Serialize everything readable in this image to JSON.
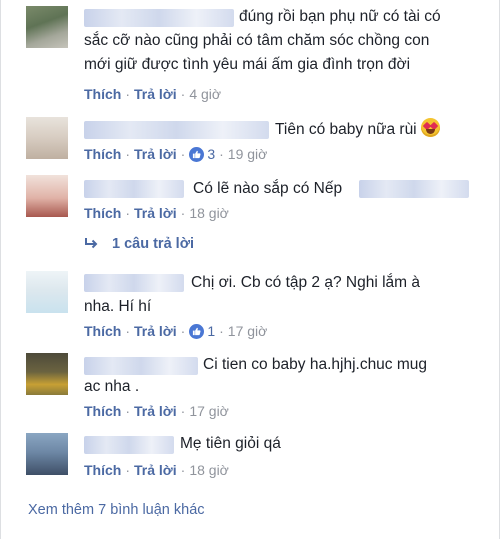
{
  "labels": {
    "like": "Thích",
    "reply": "Trả lời",
    "sep": "·"
  },
  "comments": [
    {
      "lines": [
        "đúng rồi bạn phụ nữ có tài có",
        "sắc cỡ nào cũng phải có tâm chăm sóc chồng con",
        "mới giữ được tình yêu mái ấm gia đình trọn đời"
      ],
      "likes": "",
      "time": "4 giờ"
    },
    {
      "lines": [
        "Tiên có baby nữa rùi"
      ],
      "emoji": "heart-eyes-emoji",
      "likes": "3",
      "time": "19 giờ"
    },
    {
      "lines": [
        "Có lẽ nào sắp có Nếp"
      ],
      "likes": "",
      "time": "18 giờ",
      "replies": "1 câu trả lời"
    },
    {
      "lines": [
        "Chị ơi. Cb có tập 2 ạ? Nghi lắm à",
        "nha. Hí hí"
      ],
      "likes": "1",
      "time": "17 giờ"
    },
    {
      "lines": [
        "Ci tien co baby ha.hjhj.chuc mug",
        "ac nha ."
      ],
      "likes": "",
      "time": "17 giờ"
    },
    {
      "lines": [
        "Mẹ tiên giỏi qá"
      ],
      "likes": "",
      "time": "18 giờ"
    }
  ],
  "footer": {
    "more_comments": "Xem thêm 7 bình luận khác"
  },
  "colors": {
    "link": "#4b69a3",
    "meta": "#90949c",
    "text": "#1d2129",
    "like_badge": "#4a77d4"
  }
}
